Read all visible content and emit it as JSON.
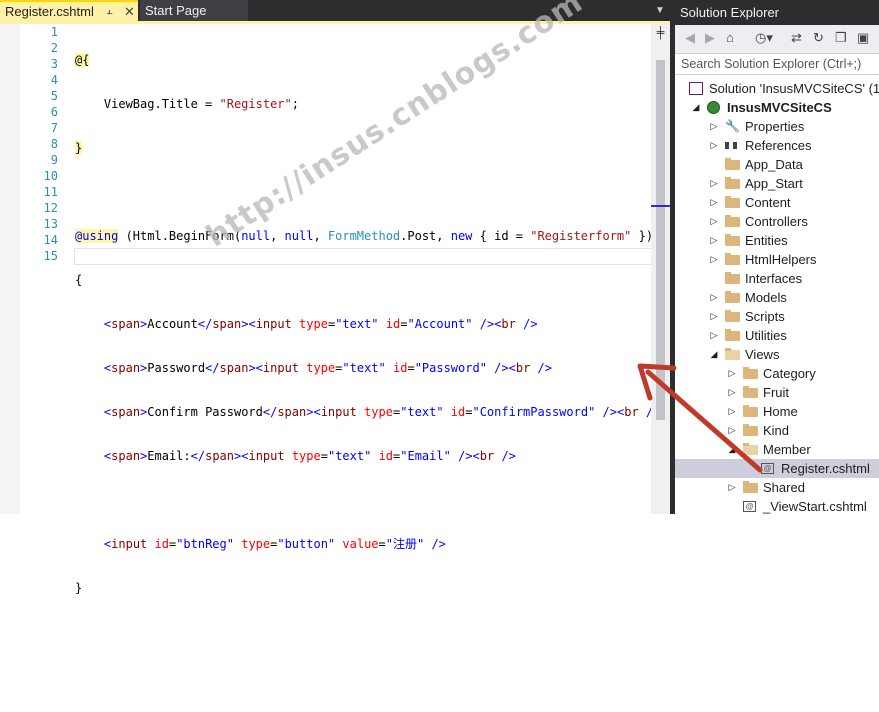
{
  "editor": {
    "tabs": [
      {
        "label": "Register.cshtml",
        "active": true
      },
      {
        "label": "Start Page",
        "active": false
      }
    ],
    "line_numbers": [
      "1",
      "2",
      "3",
      "4",
      "5",
      "6",
      "7",
      "8",
      "9",
      "10",
      "11",
      "12",
      "13",
      "14",
      "15"
    ],
    "code": {
      "l1": "@{",
      "l2_a": "    ViewBag.Title = ",
      "l2_b": "\"Register\"",
      "l2_c": ";",
      "l3": "}",
      "l5_a": "@using",
      "l5_b": " (Html.BeginForm(",
      "l5_c": "null",
      "l5_d": ", ",
      "l5_e": "null",
      "l5_f": ", ",
      "l5_g": "FormMethod",
      "l5_h": ".Post, ",
      "l5_i": "new",
      "l5_j": " { id = ",
      "l5_k": "\"Registerform\"",
      "l5_l": " }))",
      "l6": "{",
      "l7": "    <span>Account</span><input type=\"text\" id=\"Account\" /><br />",
      "l8": "    <span>Password</span><input type=\"text\" id=\"Password\" /><br />",
      "l9": "    <span>Confirm Password</span><input type=\"text\" id=\"ConfirmPassword\" /><br />",
      "l10": "    <span>Email:</span><input type=\"text\" id=\"Email\" /><br />",
      "l12": "    <input id=\"btnReg\" type=\"button\" value=\"注册\" />",
      "l13": "}"
    },
    "watermark": "http://insus.cnblogs.com"
  },
  "solution_explorer": {
    "title": "Solution Explorer",
    "search_placeholder": "Search Solution Explorer (Ctrl+;)",
    "items": [
      {
        "label": "Solution 'InsusMVCSiteCS' (1",
        "level": 0,
        "icon": "solution-icon"
      },
      {
        "label": "InsusMVCSiteCS",
        "level": 1,
        "icon": "web-project-icon",
        "expanded": true
      },
      {
        "label": "Properties",
        "level": 2,
        "icon": "wrench-icon"
      },
      {
        "label": "References",
        "level": 2,
        "icon": "references-icon"
      },
      {
        "label": "App_Data",
        "level": 2,
        "icon": "folder-icon"
      },
      {
        "label": "App_Start",
        "level": 2,
        "icon": "folder-icon"
      },
      {
        "label": "Content",
        "level": 2,
        "icon": "folder-icon"
      },
      {
        "label": "Controllers",
        "level": 2,
        "icon": "folder-icon"
      },
      {
        "label": "Entities",
        "level": 2,
        "icon": "folder-icon"
      },
      {
        "label": "HtmlHelpers",
        "level": 2,
        "icon": "folder-icon"
      },
      {
        "label": "Interfaces",
        "level": 2,
        "icon": "folder-icon"
      },
      {
        "label": "Models",
        "level": 2,
        "icon": "folder-icon"
      },
      {
        "label": "Scripts",
        "level": 2,
        "icon": "folder-icon"
      },
      {
        "label": "Utilities",
        "level": 2,
        "icon": "folder-icon"
      },
      {
        "label": "Views",
        "level": 2,
        "icon": "folder-open-icon",
        "expanded": true
      },
      {
        "label": "Category",
        "level": 3,
        "icon": "folder-icon"
      },
      {
        "label": "Fruit",
        "level": 3,
        "icon": "folder-icon"
      },
      {
        "label": "Home",
        "level": 3,
        "icon": "folder-icon"
      },
      {
        "label": "Kind",
        "level": 3,
        "icon": "folder-icon"
      },
      {
        "label": "Member",
        "level": 3,
        "icon": "folder-open-icon",
        "expanded": true
      },
      {
        "label": "Register.cshtml",
        "level": 4,
        "icon": "cshtml-file-icon",
        "selected": true
      },
      {
        "label": "Shared",
        "level": 3,
        "icon": "folder-icon"
      },
      {
        "label": "_ViewStart.cshtml",
        "level": 3,
        "icon": "cshtml-file-icon"
      }
    ]
  },
  "colors": {
    "accent_tab": "#fff1a8",
    "annotation_arrow": "#c0392b"
  }
}
